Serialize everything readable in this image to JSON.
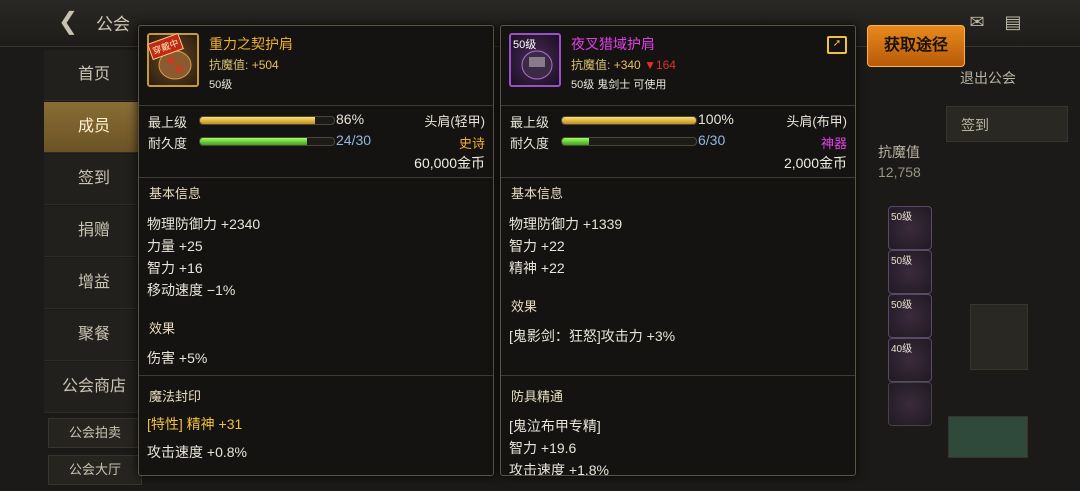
{
  "topbar": {
    "title": "公会",
    "icons": [
      "mail-icon",
      "chat-icon"
    ]
  },
  "sidebar": {
    "items": [
      {
        "label": "首页"
      },
      {
        "label": "成员",
        "active": true
      },
      {
        "label": "签到"
      },
      {
        "label": "捐赠"
      },
      {
        "label": "增益"
      },
      {
        "label": "聚餐"
      },
      {
        "label": "公会商店"
      }
    ],
    "sub_items": [
      {
        "label": "公会拍卖"
      },
      {
        "label": "公会大厅"
      }
    ]
  },
  "right_bg": {
    "exit_text": "退出公会",
    "sign_text": "签到",
    "resist_label": "抗魔值",
    "resist_value": "12,758",
    "slots": [
      "50级",
      "50级",
      "50级",
      "40级"
    ]
  },
  "get_source_button": "获取途径",
  "left_item": {
    "badge": "穿戴中",
    "icon": "shoulder-armor-icon",
    "name": "重力之契护肩",
    "resist_label": "抗魔值:",
    "resist_value": "+504",
    "level_line": "50级",
    "max_level_label": "最上级",
    "max_level_pct": 86,
    "max_level_text": "86%",
    "durability_label": "耐久度",
    "durability_pct": 80,
    "durability_text": "24/30",
    "slot_type": "头肩(轻甲)",
    "rarity": "史诗",
    "price": "60,000金币",
    "basic_title": "基本信息",
    "basic_attrs": [
      "物理防御力 +2340",
      "力量 +25",
      "智力 +16",
      "移动速度 −1%"
    ],
    "effect_title": "效果",
    "effect_line": "伤害 +5%",
    "seal_title": "魔法封印",
    "seal_tag": "[特性]",
    "seal_line": "精神 +31",
    "seal_line2": "攻击速度 +0.8%"
  },
  "right_item": {
    "level_tag": "50级",
    "icon": "shoulder-armor-icon",
    "name": "夜叉猎域护肩",
    "resist_label": "抗魔值:",
    "resist_value": "+340",
    "resist_diff": "▼164",
    "level_line": "50级 鬼剑士 可使用",
    "max_level_label": "最上级",
    "max_level_pct": 100,
    "max_level_text": "100%",
    "durability_label": "耐久度",
    "durability_pct": 20,
    "durability_text": "6/30",
    "slot_type": "头肩(布甲)",
    "rarity": "神器",
    "price": "2,000金币",
    "basic_title": "基本信息",
    "basic_attrs": [
      "物理防御力 +1339",
      "智力 +22",
      "精神 +22"
    ],
    "effect_title": "效果",
    "effect_line": "[鬼影剑：狂怒]攻击力 +3%",
    "mastery_title": "防具精通",
    "mastery_line1": "[鬼泣布甲专精]",
    "mastery_line2": "智力 +19.6",
    "mastery_line3": "攻击速度 +1.8%"
  },
  "colors": {
    "epic": "#f0b030",
    "artifact": "#e040e8",
    "accent": "#e88a1c"
  }
}
